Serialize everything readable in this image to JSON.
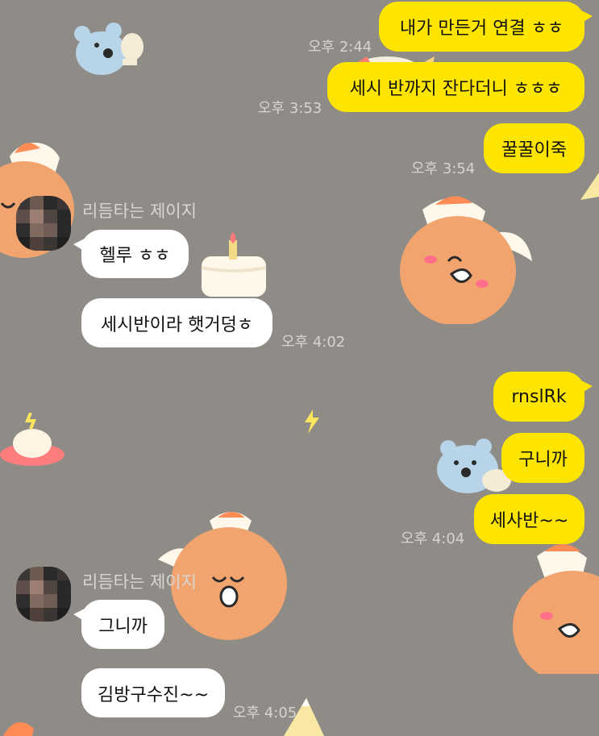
{
  "messages": {
    "m1": "내가 만든거 연결 ㅎㅎ",
    "m2": "세시 반까지 잔다더니 ㅎㅎㅎ",
    "m3": "꿀꿀이죽",
    "m4": "헬루 ㅎㅎ",
    "m5": "세시반이라 햇거덩ㅎ",
    "m6": "rnslRk",
    "m7": "구니까",
    "m8": "세사반~~",
    "m9": "그니까",
    "m10": "김방구수진~~"
  },
  "times": {
    "t1": "오후 2:44",
    "t2": "오후 3:53",
    "t3": "오후 3:54",
    "t4": "오후 4:02",
    "t5": "오후 4:04",
    "t6": "오후 4:05"
  },
  "sender": {
    "name": "리듬타는 제이지"
  },
  "colors": {
    "background": "#8f8c87",
    "my_bubble": "#fee500",
    "their_bubble": "#ffffff",
    "time_text": "#d7d4cf"
  },
  "icons": {
    "avatar": "pixelated-profile-avatar",
    "stickers": [
      "bear-sticker",
      "peach-face-sticker",
      "cake-sticker",
      "ufo-sticker",
      "lightning-icon",
      "party-hat-icon"
    ]
  }
}
